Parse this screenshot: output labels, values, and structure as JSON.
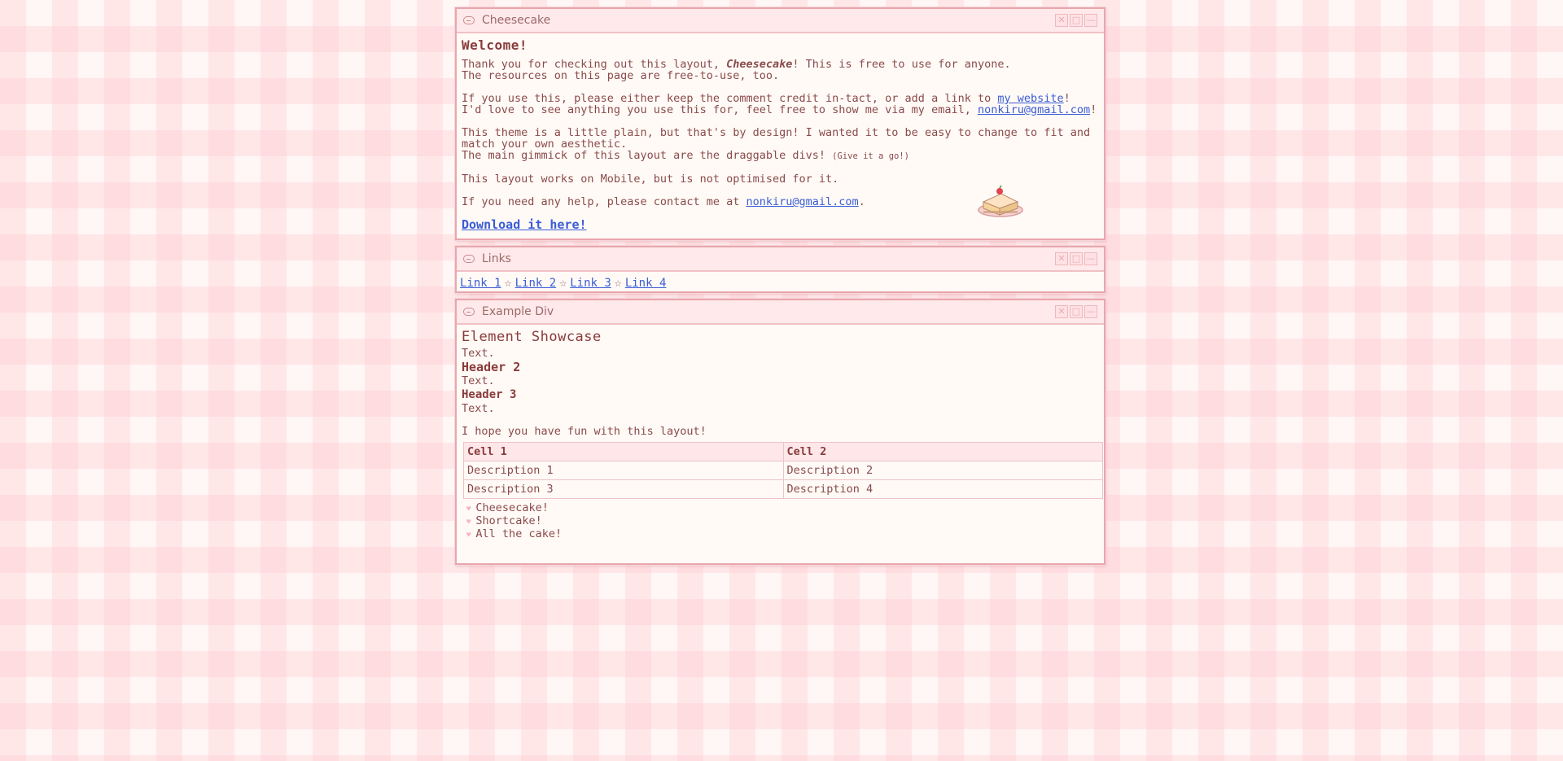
{
  "window_controls": {
    "close": "✕",
    "maximize": "□",
    "minimize": "—"
  },
  "windows": {
    "cheesecake": {
      "title": "Cheesecake",
      "heading": "Welcome!",
      "p1_pre": "Thank you for checking out this layout, ",
      "p1_em": "Cheesecake",
      "p1_post": "! This is free to use for anyone.",
      "p1_line2": "The resources on this page are free-to-use, too.",
      "p2_pre": "If you use this, please either keep the comment credit in-tact, or add a link to ",
      "p2_link": "my website",
      "p2_post": "!",
      "p2_line2_pre": "I'd love to see anything you use this for, feel free to show me via my email, ",
      "p2_email": "nonkiru@gmail.com",
      "p2_line2_post": "!",
      "p3_line1": "This theme is a little plain, but that's by design! I wanted it to be easy to change to fit and match your own aesthetic.",
      "p3_line2": "The main gimmick of this layout are the draggable divs! ",
      "p3_small": "(Give it a go!)",
      "p4": "This layout works on Mobile, but is not optimised for it.",
      "p5_pre": "If you need any help, please contact me at ",
      "p5_email": "nonkiru@gmail.com",
      "p5_post": ".",
      "download": "Download it here!"
    },
    "links": {
      "title": "Links",
      "items": [
        "Link 1",
        "Link 2",
        "Link 3",
        "Link 4"
      ],
      "separator": "☆"
    },
    "example": {
      "title": "Example Div",
      "h1": "Element Showcase",
      "text1": "Text.",
      "h2": "Header 2",
      "text2": "Text.",
      "h3": "Header 3",
      "text3": "Text.",
      "p": "I hope you have fun with this layout!",
      "table": {
        "headers": [
          "Cell 1",
          "Cell 2"
        ],
        "rows": [
          [
            "Description 1",
            "Description 2"
          ],
          [
            "Description 3",
            "Description 4"
          ]
        ]
      },
      "list": [
        "Cheesecake!",
        "Shortcake!",
        "All the cake!"
      ],
      "bullet": "♥"
    }
  }
}
